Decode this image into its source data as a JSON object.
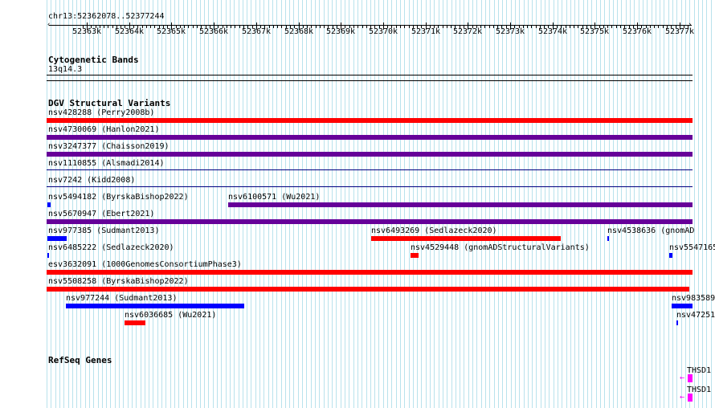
{
  "position": "chr13:52362078..52377244",
  "ruler": {
    "ticks": [
      "52363k",
      "52364k",
      "52365k",
      "52366k",
      "52367k",
      "52368k",
      "52369k",
      "52370k",
      "52371k",
      "52372k",
      "52373k",
      "52374k",
      "52375k",
      "52376k",
      "52377k"
    ]
  },
  "tracks": {
    "cytoband": {
      "title": "Cytogenetic Bands",
      "band": "13q14.3"
    },
    "dgv": {
      "title": "DGV Structural Variants",
      "features": [
        {
          "label": "nsv428288 (Perry2008b)",
          "color": "#ff0000"
        },
        {
          "label": "nsv4730069 (Hanlon2021)",
          "color": "#660099"
        },
        {
          "label": "nsv3247377 (Chaisson2019)",
          "color": "#660099"
        },
        {
          "label": "nsv1110855 (Alsmadi2014)",
          "color": "#000080"
        },
        {
          "label": "nsv7242 (Kidd2008)",
          "color": "#000080"
        },
        {
          "label": "nsv5494182 (ByrskaBishop2022)",
          "color": "#0000ff"
        },
        {
          "label": "nsv6100571 (Wu2021)",
          "color": "#660099"
        },
        {
          "label": "nsv5670947 (Ebert2021)",
          "color": "#660099"
        },
        {
          "label": "nsv977385 (Sudmant2013)",
          "color": "#0000ff"
        },
        {
          "label": "nsv6493269 (Sedlazeck2020)",
          "color": "#ff0000"
        },
        {
          "label": "nsv4538636 (gnomAD",
          "color": "#0000ff"
        },
        {
          "label": "nsv6485222 (Sedlazeck2020)",
          "color": "#0000ff"
        },
        {
          "label": "nsv4529448 (gnomADStructuralVariants)",
          "color": "#ff0000"
        },
        {
          "label": "nsv5547165",
          "color": "#0000ff"
        },
        {
          "label": "esv3632091 (1000GenomesConsortiumPhase3)",
          "color": "#ff0000"
        },
        {
          "label": "nsv5508258 (ByrskaBishop2022)",
          "color": "#ff0000"
        },
        {
          "label": "nsv977244 (Sudmant2013)",
          "color": "#0000ff"
        },
        {
          "label": "nsv983589",
          "color": "#0000ff"
        },
        {
          "label": "nsv6036685 (Wu2021)",
          "color": "#ff0000"
        },
        {
          "label": "nsv47251",
          "color": "#0000ff"
        }
      ]
    },
    "refseq": {
      "title": "RefSeq Genes",
      "genes": [
        {
          "label": "THSD1",
          "color": "#ff00ff"
        },
        {
          "label": "THSD1",
          "color": "#ff00ff"
        }
      ]
    }
  },
  "colors": {
    "grid": "#b9e2ec",
    "loss": "#ff0000",
    "gain": "#0000ff",
    "complex": "#660099",
    "gene": "#ff00ff"
  }
}
